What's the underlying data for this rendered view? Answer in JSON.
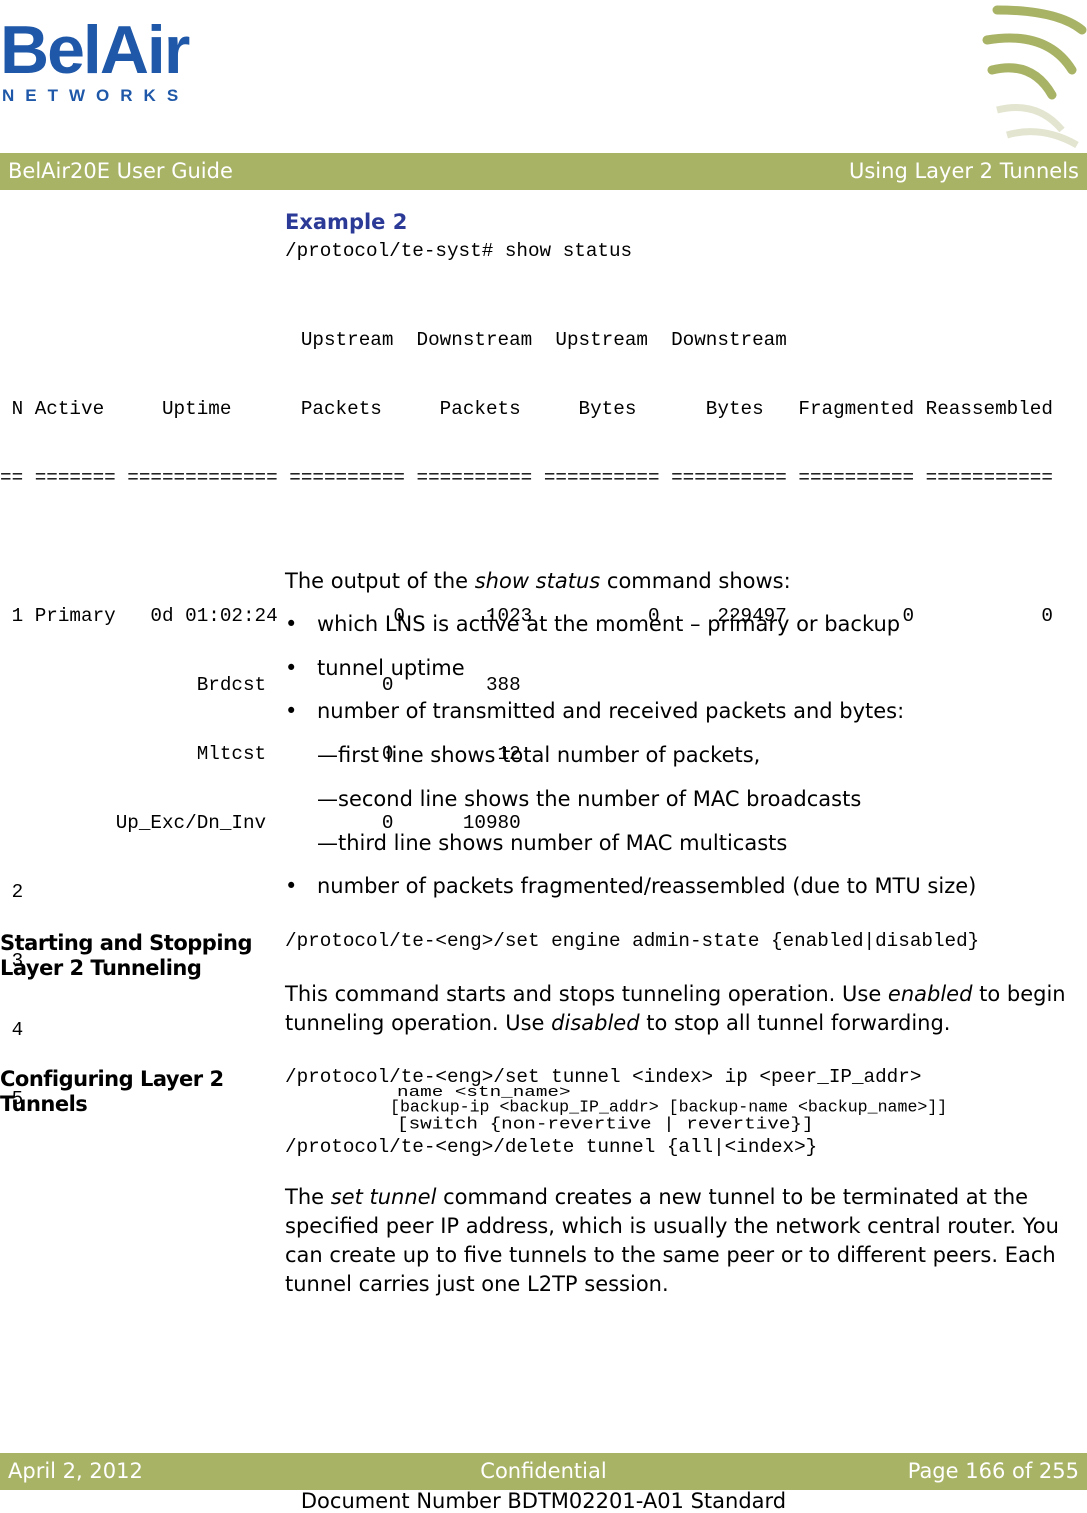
{
  "header": {
    "logo_main": "BelAir",
    "logo_sub": "NETWORKS",
    "left": "BelAir20E User Guide",
    "right": "Using Layer 2 Tunnels"
  },
  "example": {
    "title": "Example 2",
    "command": "/protocol/te-syst# show status"
  },
  "status_table": {
    "header_line1": "                          Upstream  Downstream  Upstream  Downstream",
    "header_line2": " N Active     Uptime      Packets     Packets     Bytes      Bytes   Fragmented Reassembled",
    "separator": "== ======= ============= ========== ========== ========== ========== ========== ===========",
    "rows": [
      " 1 Primary   0d 01:02:24          0       1023          0     229497          0           0",
      "                 Brdcst          0        388",
      "                 Mltcst          0         12",
      "          Up_Exc/Dn_Inv          0      10980",
      " 2",
      " 3",
      " 4",
      " 5"
    ]
  },
  "output_intro": {
    "prefix": "The output of the ",
    "command": "show status",
    "suffix": " command shows:"
  },
  "bullets": [
    "which LNS is active at the moment – primary or backup",
    "tunnel uptime",
    "number of transmitted and received packets and bytes:"
  ],
  "sub_bullets": [
    "—first line shows total number of packets,",
    "—second line shows the number of MAC broadcasts",
    "—third line shows number of MAC multicasts"
  ],
  "last_bullet": "number of packets fragmented/reassembled (due to MTU size)",
  "bullet_char": "•",
  "section_start_stop": {
    "heading_line1": "Starting and Stopping",
    "heading_line2": "Layer 2 Tunneling",
    "command": "/protocol/te-<eng>/set engine admin-state {enabled|disabled}",
    "text_a": "This command starts and stops tunneling operation. Use ",
    "em_a": "enabled",
    "text_b": " to begin tunneling operation. Use ",
    "em_b": "disabled",
    "text_c": " to stop all tunnel forwarding."
  },
  "section_configure": {
    "heading_line1": "Configuring Layer 2",
    "heading_line2": "Tunnels",
    "cmd_line1": "/protocol/te-<eng>/set tunnel <index> ip <peer_IP_addr>",
    "cmd_line2": "name <stn_name>",
    "cmd_line3": "[backup-ip <backup_IP_addr> [backup-name <backup_name>]]",
    "cmd_line4": "[switch {non-revertive | revertive}]",
    "cmd_line5": "/protocol/te-<eng>/delete tunnel {all|<index>}",
    "text_a": "The ",
    "em_a": "set tunnel",
    "text_b": " command creates a new tunnel to be terminated at the specified peer IP address, which is usually the network central router. You can create up to five tunnels to the same peer or to different peers. Each tunnel carries just one L2TP session."
  },
  "footer": {
    "date": "April 2, 2012",
    "classification": "Confidential",
    "page": "Page 166 of 255",
    "document_number": "Document Number BDTM02201-A01 Standard"
  },
  "colors": {
    "brand_blue": "#1f58a8",
    "band_green": "#a9b366",
    "example_title": "#2b3a96"
  }
}
